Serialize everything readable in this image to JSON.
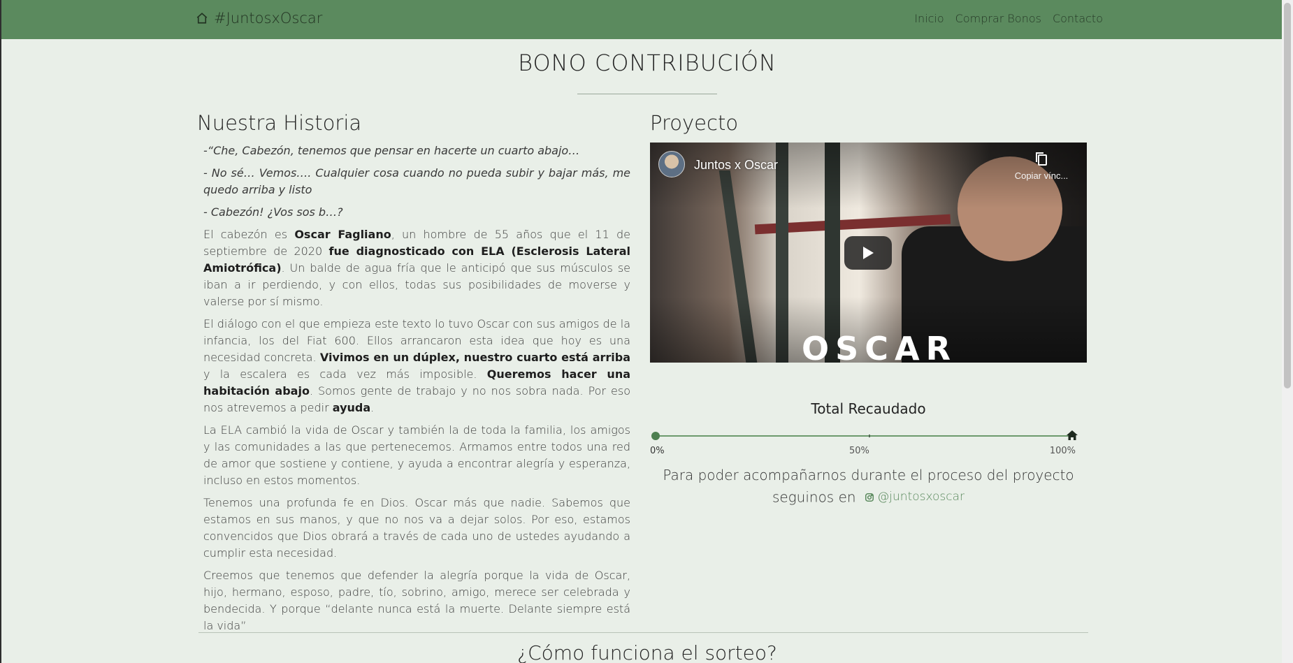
{
  "nav": {
    "brand": "#JuntosxOscar",
    "links": [
      "Inicio",
      "Comprar Bonos",
      "Contacto"
    ]
  },
  "page_title": "BONO CONTRIBUCIÓN",
  "left": {
    "heading": "Nuestra Historia",
    "dialog": [
      "-“Che, Cabezón, tenemos que pensar en hacerte un cuarto abajo…",
      "- No sé… Vemos…. Cualquier cosa cuando no pueda subir y bajar más, me quedo arriba y listo",
      "- Cabezón! ¿Vos sos b…?"
    ],
    "p1": {
      "a": "El cabezón es ",
      "b": "Oscar Fagliano",
      "c": ", un hombre de 55 años que el 11 de septiembre de 2020 ",
      "d": "fue diagnosticado con ELA (Esclerosis Lateral Amiotrófica)",
      "e": ". Un balde de agua fría que le anticipó que sus músculos se iban a ir perdiendo, y con ellos, todas sus posibilidades de moverse y valerse por sí mismo."
    },
    "p2": {
      "a": "El diálogo con el que empieza este texto lo tuvo Oscar con sus amigos de la infancia, los del Fiat 600. Ellos arrancaron esta idea que hoy es una necesidad concreta. ",
      "b": "Vivimos en un dúplex, nuestro cuarto está arriba",
      "c": " y la escalera es cada vez más imposible. ",
      "d": "Queremos hacer una habitación abajo",
      "e": ". Somos gente de trabajo y no nos sobra nada. Por eso nos atrevemos a pedir ",
      "f": "ayuda",
      "g": "."
    },
    "p3": "La ELA cambió la vida de Oscar y también la de toda la familia, los amigos y las comunidades a las que pertenecemos. Armamos entre todos una red de amor que sostiene y contiene, y ayuda a encontrar alegría y esperanza, incluso en estos momentos.",
    "p4": "Tenemos una profunda fe en Dios. Oscar más que nadie. Sabemos que estamos en sus manos, y que no nos va a dejar solos. Por eso, estamos convencidos que Dios obrará a través de cada uno de ustedes ayudando a cumplir esta necesidad.",
    "p5": "Creemos que tenemos que defender la alegría porque la vida de Oscar, hijo, hermano, esposo, padre, tío, sobrino, amigo, merece ser celebrada y bendecida. Y porque “delante nunca está la muerte. Delante siempre está la vida”"
  },
  "right": {
    "heading": "Proyecto",
    "video": {
      "title": "Juntos x Oscar",
      "copy_label": "Copiar vínc...",
      "overlay_text": "OSCAR"
    },
    "total_title": "Total Recaudado",
    "progress": {
      "value_fraction": 0.0,
      "labels": [
        "0%",
        "50%",
        "100%"
      ]
    },
    "follow_text": "Para poder acompañarnos durante el proceso del proyecto seguinos en",
    "instagram": "@juntosxoscar"
  },
  "bottom_heading": "¿Cómo funciona el sorteo?",
  "colors": {
    "navbar": "#5b8a5e",
    "background": "#e9efe8",
    "accent": "#5b8a5e"
  }
}
